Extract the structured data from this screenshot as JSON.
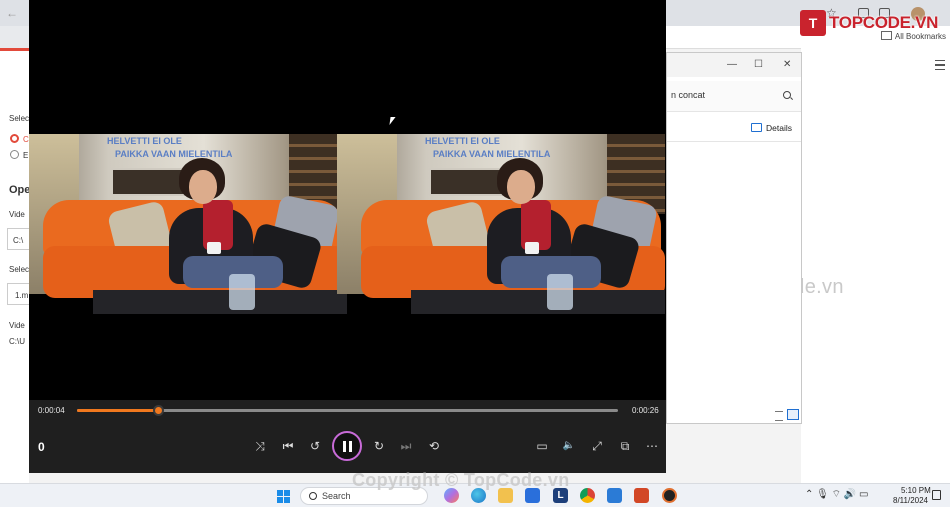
{
  "browser": {
    "all_bookmarks": "All Bookmarks"
  },
  "left_app": {
    "select_label": "Selec",
    "radio_1_label": "C",
    "radio_2_label": "E",
    "open_heading": "Ope",
    "video_label": "Vide",
    "path_value": "C:\\",
    "select_label_2": "Selec",
    "file_value": "1.m",
    "video_label_2": "Vide",
    "path_value_2": "C:\\U"
  },
  "explorer": {
    "search_text": "n concat",
    "details_label": "Details",
    "minimize": "—",
    "maximize": "☐",
    "close": "✕"
  },
  "logo": {
    "mark": "T",
    "text": "TOPCODE.VN"
  },
  "watermark": {
    "middle": "TopCode.vn",
    "bottom": "Copyright © TopCode.vn"
  },
  "video": {
    "sign_line_1": "HELVETTI EI OLE",
    "sign_line_2": "PAIKKA VAAN MIELENTILA"
  },
  "player": {
    "time_current": "0:00:04",
    "time_total": "0:00:26",
    "progress": 0.15,
    "speed_readout": "0",
    "accent_color": "#f0781e",
    "controls_left": [
      {
        "name": "shuffle-icon",
        "glyph": "⤨"
      },
      {
        "name": "previous-icon",
        "glyph": "⏮"
      },
      {
        "name": "rewind-10-icon",
        "glyph": "↺"
      },
      {
        "name": "pause-icon",
        "glyph": ""
      },
      {
        "name": "forward-30-icon",
        "glyph": "↻"
      },
      {
        "name": "next-icon",
        "glyph": "⏭"
      },
      {
        "name": "repeat-icon",
        "glyph": "⟲"
      }
    ],
    "controls_right": [
      {
        "name": "subtitles-icon",
        "glyph": "▭"
      },
      {
        "name": "volume-icon",
        "glyph": "🔈"
      },
      {
        "name": "fullscreen-icon",
        "glyph": "⤢"
      },
      {
        "name": "mini-player-icon",
        "glyph": "⧉"
      },
      {
        "name": "more-icon",
        "glyph": "⋯"
      }
    ]
  },
  "taskbar": {
    "search_placeholder": "Search",
    "clock_time": "5:10 PM",
    "clock_date": "8/11/2024",
    "tray_glyphs": "⌃  🎙  ⌔  🔊  ▭"
  }
}
